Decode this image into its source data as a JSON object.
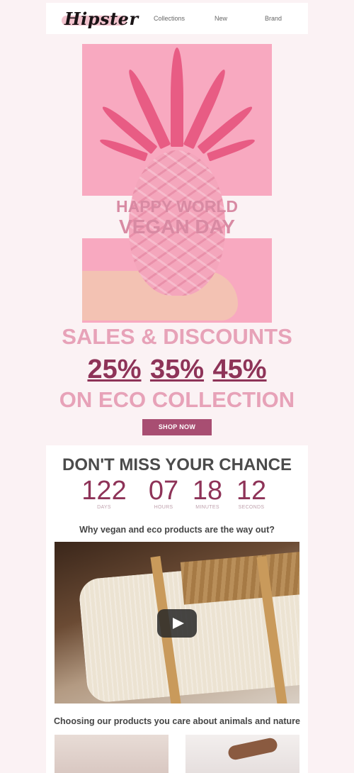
{
  "header": {
    "logo": "Hipster",
    "nav": [
      "Collections",
      "New",
      "Brand"
    ]
  },
  "hero": {
    "line1": "HAPPY WORLD",
    "line2": "VEGAN DAY"
  },
  "sales": {
    "headline": "SALES & DISCOUNTS",
    "percents": [
      "25%",
      "35%",
      "45%"
    ],
    "subline": "ON ECO COLLECTION",
    "cta": "SHOP NOW"
  },
  "countdown": {
    "title": "DON'T MISS YOUR CHANCE",
    "items": [
      {
        "value": "122",
        "label": "DAYS"
      },
      {
        "value": "07",
        "label": "HOURS"
      },
      {
        "value": "18",
        "label": "MINUTES"
      },
      {
        "value": "12",
        "label": "SECONDS"
      }
    ]
  },
  "content": {
    "question": "Why vegan and eco products are the way out?",
    "tagline": "Choosing our products you care about animals and nature"
  },
  "colors": {
    "accent": "#8e3358",
    "pink": "#f8a9c0",
    "button": "#a84e72"
  },
  "icons": {
    "video": "play-icon"
  }
}
